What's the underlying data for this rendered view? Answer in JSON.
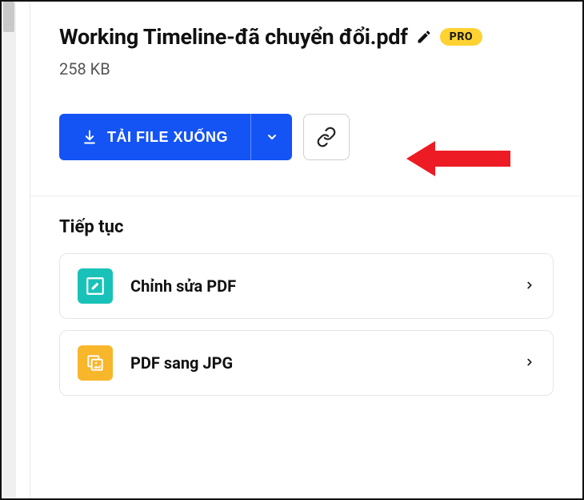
{
  "file": {
    "name": "Working Timeline-đã chuyển đổi.pdf",
    "size": "258 KB"
  },
  "badge": {
    "pro": "PRO"
  },
  "actions": {
    "download_label": "TẢI FILE XUỐNG"
  },
  "continue": {
    "title": "Tiếp tục",
    "items": [
      {
        "label": "Chỉnh sửa PDF"
      },
      {
        "label": "PDF sang JPG"
      }
    ]
  }
}
